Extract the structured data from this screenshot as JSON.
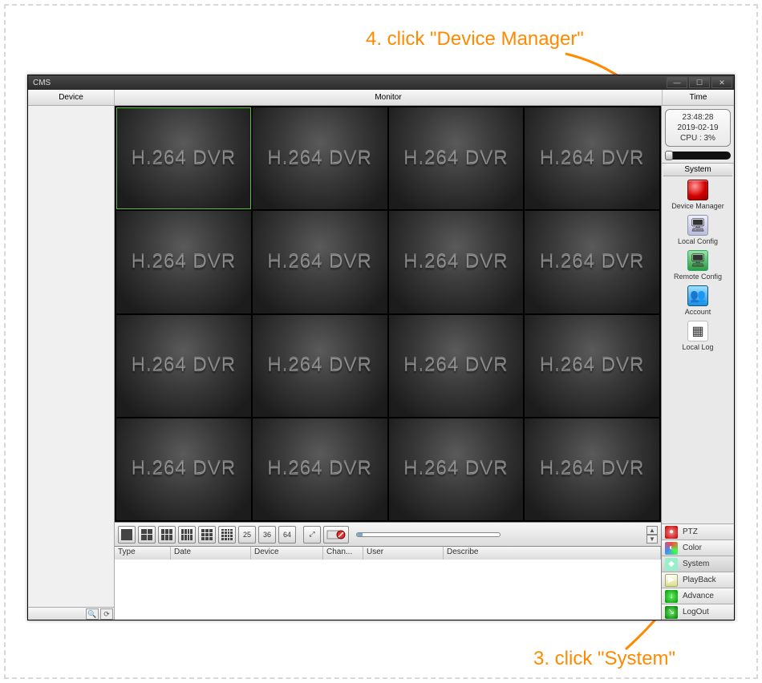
{
  "annotation": {
    "step4": "4. click \"Device Manager\"",
    "step3": "3. click \"System\""
  },
  "window": {
    "title": "CMS",
    "min": "—",
    "max": "☐",
    "close": "✕"
  },
  "header": {
    "device": "Device",
    "monitor": "Monitor",
    "time": "Time"
  },
  "clock": {
    "time": "23:48:28",
    "date": "2019-02-19",
    "cpu": "CPU : 3%"
  },
  "system_panel": {
    "tab": "System",
    "items": [
      {
        "label": "Device Manager",
        "icon": "red-dot"
      },
      {
        "label": "Local Config",
        "icon": "window"
      },
      {
        "label": "Remote Config",
        "icon": "window-green"
      },
      {
        "label": "Account",
        "icon": "users"
      },
      {
        "label": "Local Log",
        "icon": "doc"
      }
    ]
  },
  "side_tabs": [
    {
      "label": "PTZ"
    },
    {
      "label": "Color"
    },
    {
      "label": "System"
    },
    {
      "label": "PlayBack"
    },
    {
      "label": "Advance"
    },
    {
      "label": "LogOut"
    }
  ],
  "grid": {
    "cell_text": "H.264 DVR",
    "count": 16
  },
  "toolbar": {
    "buttons_num": [
      "25",
      "36",
      "64"
    ]
  },
  "log_columns": {
    "type": "Type",
    "date": "Date",
    "device": "Device",
    "chan": "Chan...",
    "user": "User",
    "describe": "Describe"
  }
}
